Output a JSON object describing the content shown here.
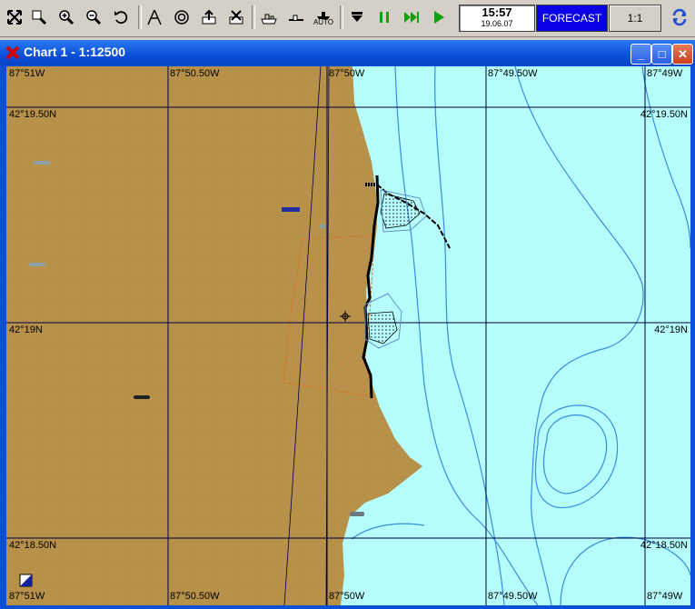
{
  "toolbar": {
    "buttons": [
      {
        "name": "zoom-fit-icon"
      },
      {
        "name": "zoom-window-icon"
      },
      {
        "name": "zoom-in-icon"
      },
      {
        "name": "zoom-out-icon"
      },
      {
        "name": "undo-view-icon"
      },
      {
        "name": "route-icon"
      },
      {
        "name": "target-icon"
      },
      {
        "name": "export-icon"
      },
      {
        "name": "import-icon"
      },
      {
        "name": "ship-view-icon"
      },
      {
        "name": "ship-center-icon"
      },
      {
        "name": "auto-mode-icon"
      },
      {
        "name": "stop-icon"
      },
      {
        "name": "pause-icon"
      },
      {
        "name": "fast-forward-icon"
      },
      {
        "name": "play-icon"
      },
      {
        "name": "refresh-icon"
      }
    ],
    "auto_label": "AUTO",
    "clock_time": "15:57",
    "clock_date": "19.06.07",
    "forecast_label": "FORECAST",
    "scale_label": "1:1"
  },
  "window": {
    "title": "Chart 1 - 1:12500",
    "minimize_label": "_",
    "maximize_label": "□",
    "close_label": "✕"
  },
  "chart": {
    "lon_labels_top": [
      "87°51W",
      "87°50.50W",
      "87°50W",
      "87°49.50W",
      "87°49W"
    ],
    "lon_labels_bottom": [
      "87°51W",
      "87°50.50W",
      "87°50W",
      "87°49.50W",
      "87°49W"
    ],
    "lat_labels": [
      "42°19.50N",
      "42°19N",
      "42°18.50N"
    ],
    "colors": {
      "land": "#b8924a",
      "water": "#b6fdfd",
      "depth_contour": "#3a8de0",
      "grid": "#000040",
      "restricted_area": "#e07020"
    }
  }
}
